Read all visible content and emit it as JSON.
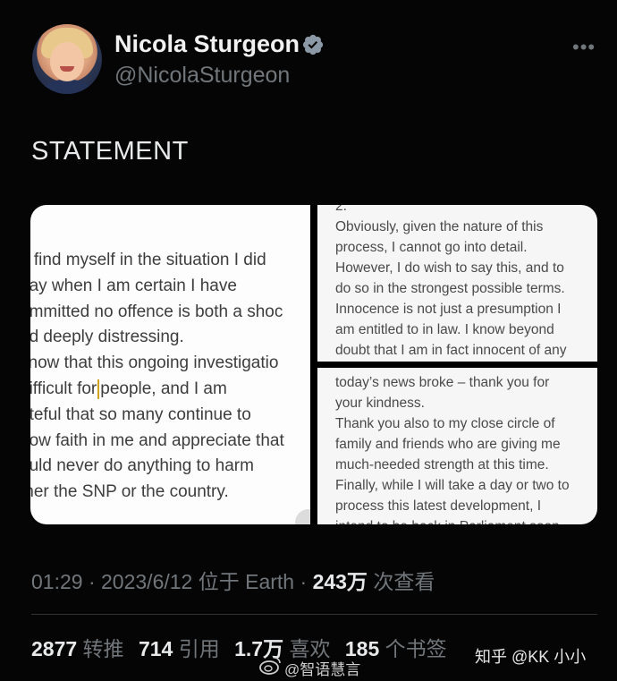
{
  "author": {
    "name": "Nicola Sturgeon",
    "handle": "@NicolaSturgeon",
    "verified_color": "#8b98a5"
  },
  "more_glyph": "•••",
  "tweet": {
    "text": "STATEMENT"
  },
  "media": {
    "left_lines": [
      "o find myself in the situation I did",
      "day when I am certain I have",
      "ommitted no offence is both a shoc",
      "nd deeply distressing.",
      "know that this ongoing investigatio",
      "difficult for",
      "people, and I am",
      "ateful that so many continue to",
      "how faith in me and appreciate that",
      "ould never do anything to harm",
      "ther the SNP or the country."
    ],
    "top_right_lines": [
      "2.",
      "Obviously, given the nature of this",
      "process, I cannot go into detail.",
      " However, I do wish to say this, and to",
      "do so in the strongest possible terms.",
      " Innocence is not just a presumption I",
      "am entitled to in law. I know beyond",
      "doubt that I am in fact innocent of any"
    ],
    "bottom_right_lines": [
      "today’s news broke – thank you for",
      "your kindness.",
      " Thank you also to my close circle of",
      "family and friends who are giving me",
      "much-needed strength at this time.",
      " Finally, while I will take a day or two to",
      "process this latest development, I",
      "intend to be back in Parliament soon"
    ]
  },
  "meta": {
    "time": "01:29",
    "dot1": " · ",
    "date": "2023/6/12",
    "location": " 位于 Earth",
    "dot2": " · ",
    "views_num": "243万",
    "views_label": " 次查看"
  },
  "stats": {
    "retweets_num": "2877",
    "retweets_label": " 转推",
    "quotes_num": "714",
    "quotes_label": " 引用",
    "likes_num": "1.7万",
    "likes_label": " 喜欢",
    "bookmarks_num": "185",
    "bookmarks_label": " 个书签"
  },
  "watermarks": {
    "weibo": "@智语慧言",
    "zhihu": "知乎 @KK 小小"
  }
}
